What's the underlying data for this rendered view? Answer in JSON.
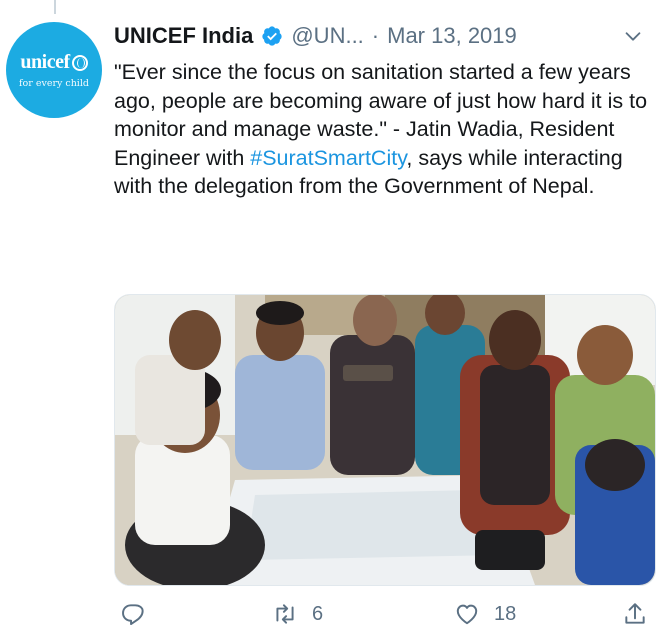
{
  "tweet": {
    "author": {
      "name": "UNICEF India",
      "handle": "@UN...",
      "avatar": {
        "logo_text": "unicef",
        "tagline": "for every child",
        "color": "#1cabe2"
      },
      "verified_icon": "verified-badge-icon"
    },
    "separator": "·",
    "date": "Mar 13, 2019",
    "text_before": "\"Ever since the focus on sanitation started a few years ago, people are becoming aware of just how hard it is to monitor and manage waste.\" - Jatin Wadia, Resident Engineer with ",
    "hashtag": "#SuratSmartCity",
    "text_after": ", says while interacting with the delegation from the Government of Nepal.",
    "actions": {
      "reply_icon": "reply-icon",
      "retweet_icon": "retweet-icon",
      "retweet_count": "6",
      "like_icon": "heart-icon",
      "like_count": "18",
      "share_icon": "share-icon"
    },
    "colors": {
      "text": "#14171a",
      "secondary": "#5b7083",
      "link": "#1b95e0",
      "verified": "#1da1f2"
    }
  }
}
